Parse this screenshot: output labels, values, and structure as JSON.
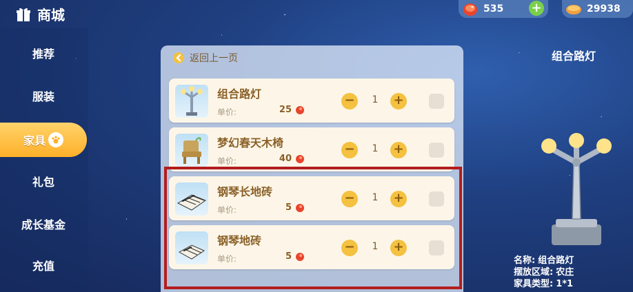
{
  "header": {
    "title": "商城",
    "currencies": [
      {
        "icon": "red-coin-icon",
        "amount": "535"
      },
      {
        "icon": "bread-icon",
        "amount": "29938"
      }
    ],
    "add_label": "+"
  },
  "sidebar": {
    "items": [
      {
        "label": "推荐"
      },
      {
        "label": "服装"
      },
      {
        "label": "家具",
        "active": true
      },
      {
        "label": "礼包"
      },
      {
        "label": "成长基金"
      },
      {
        "label": "充值"
      }
    ]
  },
  "panel": {
    "back_label": "返回上一页",
    "price_label": "单价:",
    "minus_label": "−",
    "plus_label": "+",
    "items": [
      {
        "name": "组合路灯",
        "price": "25",
        "qty": "1",
        "icon": "street-lamp-icon"
      },
      {
        "name": "梦幻春天木椅",
        "price": "40",
        "qty": "1",
        "icon": "wooden-chair-icon"
      },
      {
        "name": "钢琴长地砖",
        "price": "5",
        "qty": "1",
        "icon": "piano-tile-long-icon"
      },
      {
        "name": "钢琴地砖",
        "price": "5",
        "qty": "1",
        "icon": "piano-tile-icon"
      }
    ]
  },
  "preview": {
    "title": "组合路灯",
    "info": [
      {
        "key": "名称:",
        "value": "组合路灯"
      },
      {
        "key": "摆放区域:",
        "value": "农庄"
      },
      {
        "key": "家具类型:",
        "value": "1*1"
      }
    ]
  },
  "colors": {
    "active_tab": "#ffb02a",
    "highlight_border": "#b31d1d",
    "qty_button": "#f4c140",
    "plus_green": "#7ad04a"
  }
}
